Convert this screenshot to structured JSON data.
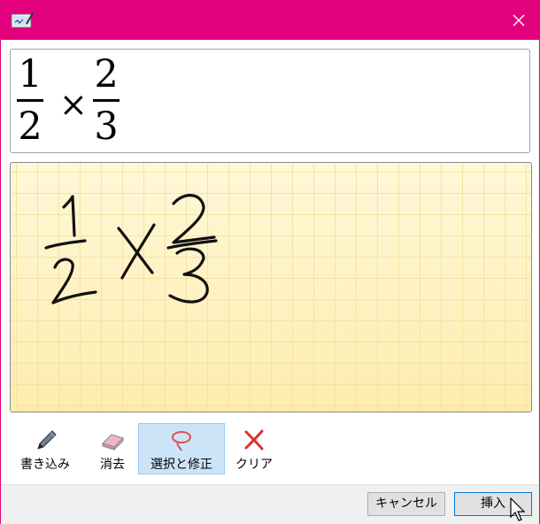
{
  "window": {
    "accent": "#e3007d",
    "app_icon": "math-input-panel-icon",
    "close_icon": "close-icon"
  },
  "preview": {
    "fraction1": {
      "numerator": "1",
      "denominator": "2"
    },
    "operator": "×",
    "fraction2": {
      "numerator": "2",
      "denominator": "3"
    }
  },
  "canvas": {
    "content": "handwritten 1/2 × 2/3",
    "grid": true
  },
  "tools": [
    {
      "label": "書き込み",
      "icon": "pen-icon",
      "selected": false
    },
    {
      "label": "消去",
      "icon": "eraser-icon",
      "selected": false
    },
    {
      "label": "選択と修正",
      "icon": "lasso-select-icon",
      "selected": true
    },
    {
      "label": "クリア",
      "icon": "clear-x-icon",
      "selected": false
    }
  ],
  "footer": {
    "cancel_label": "キャンセル",
    "insert_label": "挿入"
  }
}
